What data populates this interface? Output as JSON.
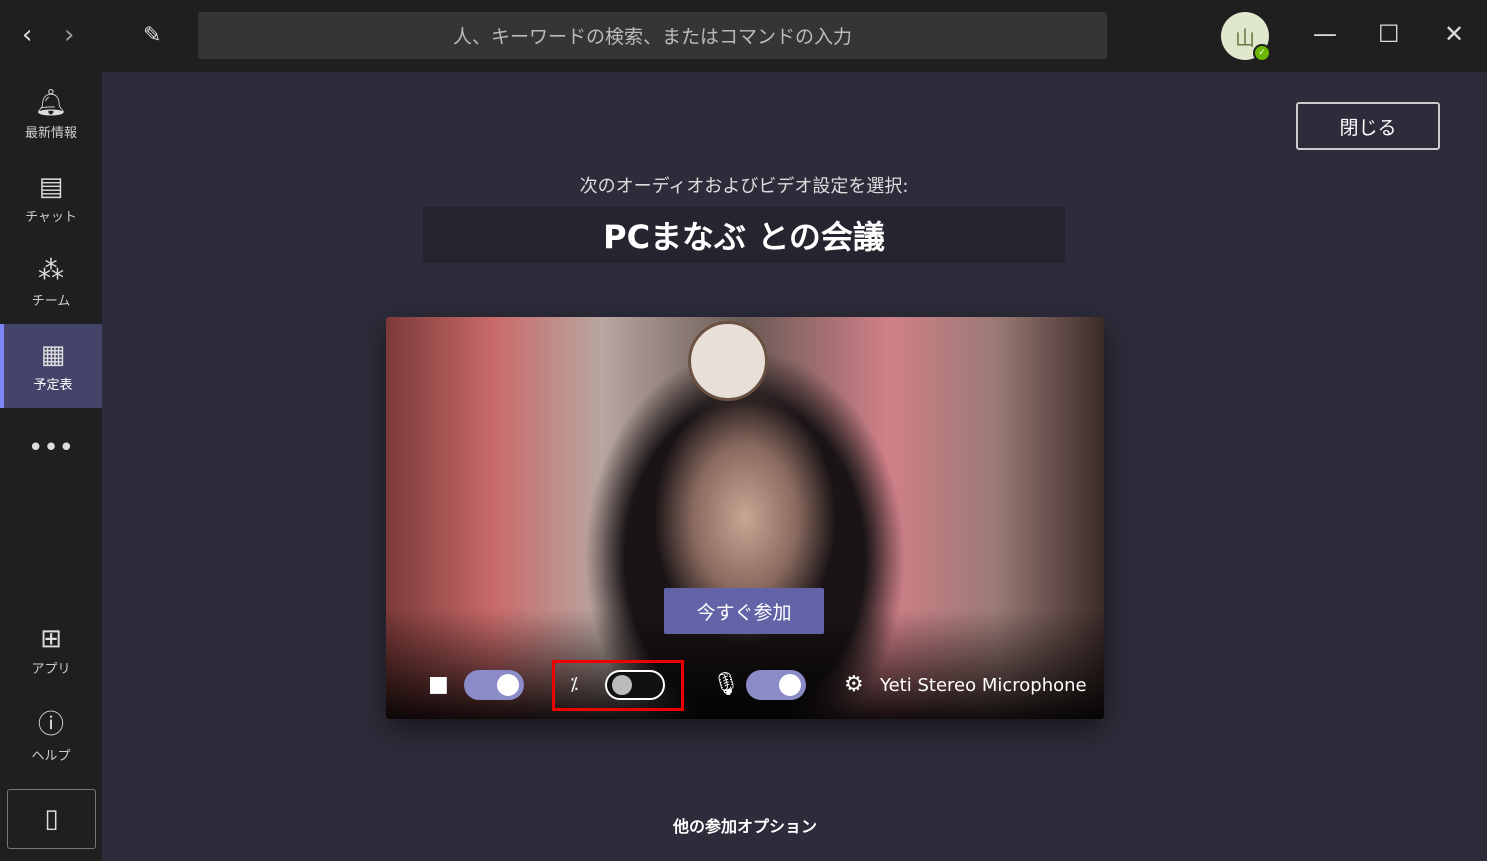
{
  "topbar": {
    "search_placeholder": "人、キーワードの検索、またはコマンドの入力",
    "avatar_initial": "山",
    "back_icon": "chevron-left",
    "forward_icon": "chevron-right",
    "compose_icon": "compose"
  },
  "sidebar": {
    "items": [
      {
        "label": "最新情報",
        "icon": "bell"
      },
      {
        "label": "チャット",
        "icon": "chat"
      },
      {
        "label": "チーム",
        "icon": "teams"
      },
      {
        "label": "予定表",
        "icon": "calendar",
        "active": true
      },
      {
        "label": "アプリ",
        "icon": "apps"
      },
      {
        "label": "ヘルプ",
        "icon": "help"
      }
    ],
    "more_label": "•••"
  },
  "main": {
    "close_label": "閉じる",
    "subtitle": "次のオーディオおよびビデオ設定を選択:",
    "meeting_title": "PCまなぶ との会議",
    "join_label": "今すぐ参加",
    "camera_on": true,
    "background_blur_on": false,
    "mic_on": true,
    "device_name": "Yeti Stereo Microphone",
    "more_options": "他の参加オプション"
  },
  "colors": {
    "accent": "#6264a7",
    "toggle_on": "#8b8cc7",
    "highlight": "#e00000"
  }
}
